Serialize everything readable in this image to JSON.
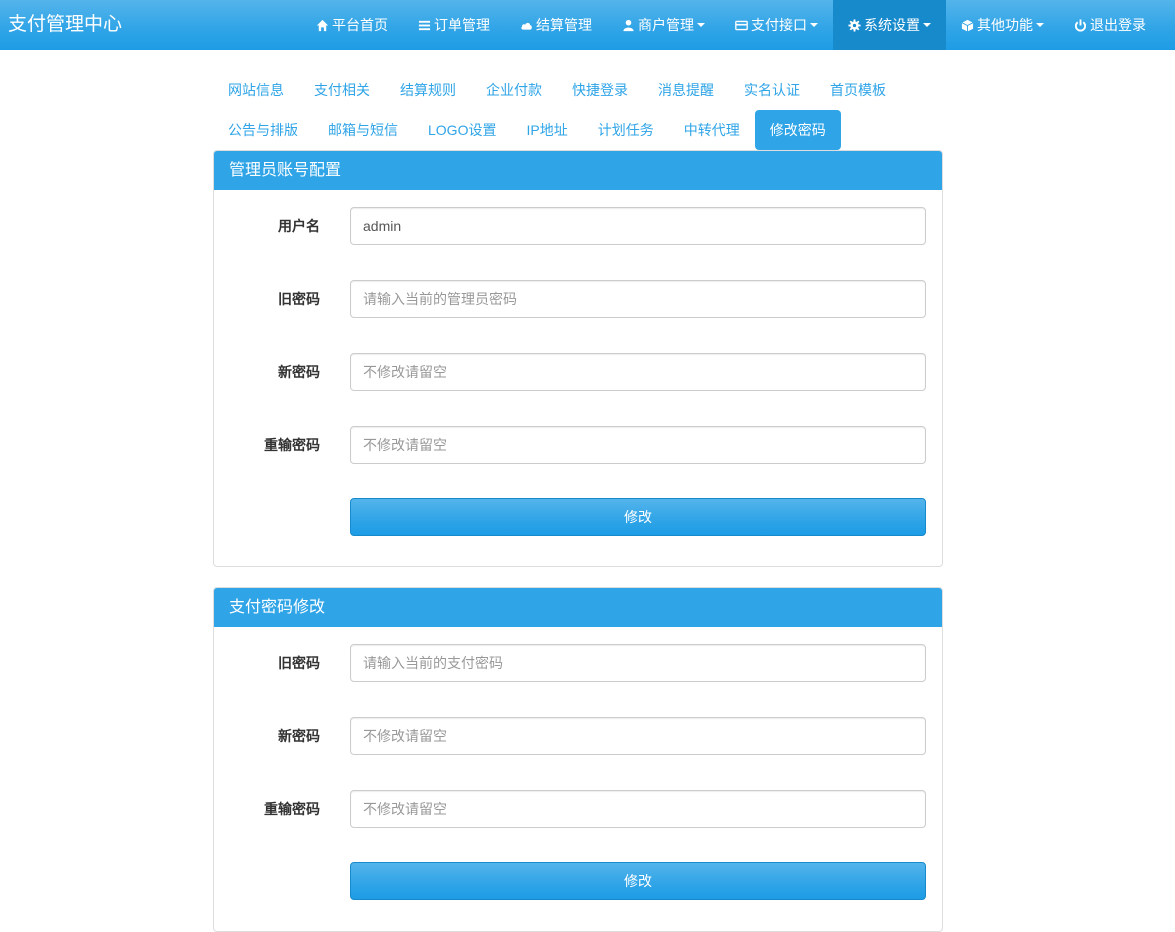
{
  "header": {
    "brand": "支付管理中心",
    "nav": [
      {
        "label": "平台首页",
        "icon": "home-icon",
        "dropdown": false,
        "active": false
      },
      {
        "label": "订单管理",
        "icon": "list-icon",
        "dropdown": false,
        "active": false
      },
      {
        "label": "结算管理",
        "icon": "cloud-icon",
        "dropdown": false,
        "active": false
      },
      {
        "label": "商户管理",
        "icon": "user-icon",
        "dropdown": true,
        "active": false
      },
      {
        "label": "支付接口",
        "icon": "credit-card-icon",
        "dropdown": true,
        "active": false
      },
      {
        "label": "系统设置",
        "icon": "gear-icon",
        "dropdown": true,
        "active": true
      },
      {
        "label": "其他功能",
        "icon": "cube-icon",
        "dropdown": true,
        "active": false
      },
      {
        "label": "退出登录",
        "icon": "power-icon",
        "dropdown": false,
        "active": false
      }
    ]
  },
  "tabs": {
    "row1": [
      "网站信息",
      "支付相关",
      "结算规则",
      "企业付款",
      "快捷登录",
      "消息提醒",
      "实名认证",
      "首页模板"
    ],
    "row2": [
      "公告与排版",
      "邮箱与短信",
      "LOGO设置",
      "IP地址",
      "计划任务",
      "中转代理",
      "修改密码"
    ],
    "active": "修改密码"
  },
  "admin_panel": {
    "title": "管理员账号配置",
    "fields": [
      {
        "label": "用户名",
        "value": "admin",
        "placeholder": ""
      },
      {
        "label": "旧密码",
        "value": "",
        "placeholder": "请输入当前的管理员密码"
      },
      {
        "label": "新密码",
        "value": "",
        "placeholder": "不修改请留空"
      },
      {
        "label": "重输密码",
        "value": "",
        "placeholder": "不修改请留空"
      }
    ],
    "submit": "修改"
  },
  "pay_panel": {
    "title": "支付密码修改",
    "fields": [
      {
        "label": "旧密码",
        "value": "",
        "placeholder": "请输入当前的支付密码"
      },
      {
        "label": "新密码",
        "value": "",
        "placeholder": "不修改请留空"
      },
      {
        "label": "重输密码",
        "value": "",
        "placeholder": "不修改请留空"
      }
    ],
    "submit": "修改"
  },
  "colors": {
    "primary": "#2fa4e7",
    "nav_active": "#178acc"
  }
}
